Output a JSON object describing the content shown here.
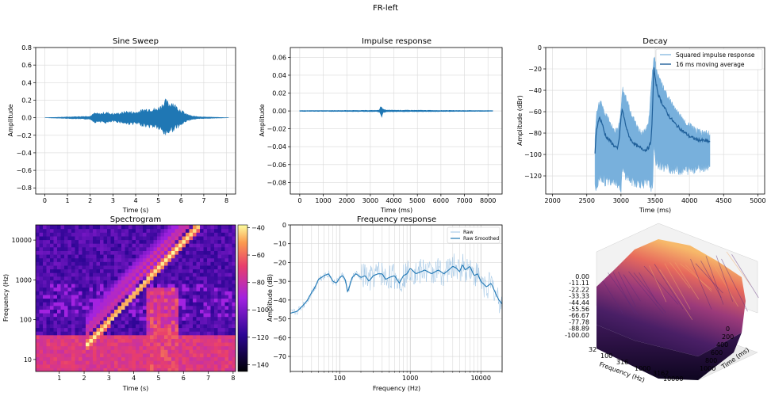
{
  "figure_title": "FR-left",
  "colors": {
    "line": "#1f77b4",
    "line_light": "#6fa8d6",
    "grid": "#d9d9d9"
  },
  "chart_data": [
    {
      "type": "line",
      "title": "Sine Sweep",
      "xlabel": "Time (s)",
      "ylabel": "Amplitude",
      "xlim": [
        -0.4,
        8.4
      ],
      "ylim": [
        -0.87,
        0.8
      ],
      "xticks": [
        "0",
        "1",
        "2",
        "3",
        "4",
        "5",
        "6",
        "7",
        "8"
      ],
      "yticks": [
        "0.8",
        "0.6",
        "0.4",
        "0.2",
        "0.0",
        "−0.2",
        "−0.4",
        "−0.6",
        "−0.8"
      ],
      "grid": true,
      "envelope": {
        "x": [
          0.0,
          1.0,
          2.0,
          2.2,
          2.4,
          2.7,
          3.0,
          3.3,
          3.6,
          4.0,
          4.3,
          4.6,
          4.9,
          5.1,
          5.3,
          5.5,
          5.6,
          5.8,
          6.0,
          6.2,
          6.5,
          7.0,
          8.1
        ],
        "max": [
          0.0,
          0.01,
          0.02,
          0.06,
          0.05,
          0.07,
          0.05,
          0.06,
          0.08,
          0.07,
          0.1,
          0.12,
          0.11,
          0.15,
          0.22,
          0.18,
          0.21,
          0.14,
          0.1,
          0.05,
          0.02,
          0.01,
          0.0
        ],
        "min": [
          0.0,
          -0.01,
          -0.02,
          -0.06,
          -0.05,
          -0.07,
          -0.05,
          -0.06,
          -0.08,
          -0.08,
          -0.1,
          -0.12,
          -0.12,
          -0.17,
          -0.22,
          -0.18,
          -0.17,
          -0.13,
          -0.1,
          -0.05,
          -0.02,
          -0.01,
          0.0
        ]
      }
    },
    {
      "type": "line",
      "title": "Impulse response",
      "xlabel": "Time (ms)",
      "ylabel": "Amplitude",
      "xlim": [
        -400,
        8600
      ],
      "ylim": [
        -0.093,
        0.071
      ],
      "xticks": [
        "0",
        "1000",
        "2000",
        "3000",
        "4000",
        "5000",
        "6000",
        "7000",
        "8000"
      ],
      "yticks": [
        "0.06",
        "0.04",
        "0.02",
        "0.00",
        "−0.02",
        "−0.04",
        "−0.06",
        "−0.08"
      ],
      "grid": true,
      "envelope": {
        "x": [
          0,
          3300,
          3400,
          3450,
          3480,
          3500,
          3550,
          3700,
          8200
        ],
        "max": [
          0.0005,
          0.0008,
          0.002,
          0.006,
          0.008,
          0.004,
          0.002,
          0.001,
          0.0005
        ],
        "min": [
          -0.0005,
          -0.0008,
          -0.002,
          -0.007,
          -0.009,
          -0.005,
          -0.002,
          -0.001,
          -0.0005
        ]
      }
    },
    {
      "type": "line",
      "title": "Decay",
      "xlabel": "Time (ms)",
      "ylabel": "Amplitude (dBr)",
      "xlim": [
        1900,
        5100
      ],
      "ylim": [
        -137,
        0
      ],
      "xticks": [
        "2000",
        "2500",
        "3000",
        "3500",
        "4000",
        "4500",
        "5000"
      ],
      "yticks": [
        "0",
        "−20",
        "−40",
        "−60",
        "−80",
        "−100",
        "−120"
      ],
      "grid": true,
      "legend": "top-right",
      "series": [
        {
          "name": "Squared impulse response",
          "x": [
            2620,
            2640,
            2700,
            2760,
            2800,
            2900,
            2950,
            3000,
            3020,
            3080,
            3150,
            3300,
            3400,
            3460,
            3480,
            3500,
            3550,
            3700,
            3900,
            4100,
            4300
          ],
          "max": [
            -80,
            -60,
            -45,
            -60,
            -62,
            -75,
            -75,
            -55,
            -35,
            -45,
            -60,
            -78,
            -70,
            -20,
            -5,
            -10,
            -25,
            -45,
            -65,
            -75,
            -78
          ],
          "min": [
            -137,
            -137,
            -125,
            -130,
            -130,
            -128,
            -132,
            -137,
            -120,
            -125,
            -130,
            -132,
            -132,
            -137,
            -100,
            -110,
            -115,
            -118,
            -120,
            -118,
            -115
          ]
        },
        {
          "name": "16 ms moving average",
          "x": [
            2620,
            2640,
            2680,
            2720,
            2760,
            2800,
            2850,
            2900,
            2950,
            2980,
            3000,
            3020,
            3060,
            3100,
            3150,
            3200,
            3250,
            3300,
            3350,
            3400,
            3440,
            3460,
            3480,
            3500,
            3550,
            3600,
            3700,
            3800,
            3900,
            4000,
            4100,
            4200,
            4300
          ],
          "y": [
            -100,
            -78,
            -65,
            -70,
            -80,
            -85,
            -88,
            -92,
            -95,
            -82,
            -65,
            -58,
            -70,
            -80,
            -87,
            -90,
            -93,
            -94,
            -96,
            -94,
            -88,
            -60,
            -17,
            -30,
            -45,
            -52,
            -64,
            -72,
            -78,
            -83,
            -86,
            -87,
            -88
          ]
        }
      ]
    },
    {
      "type": "heatmap",
      "title": "Spectrogram",
      "xlabel": "Time (s)",
      "ylabel": "Frequency (Hz)",
      "xlim": [
        0.05,
        8.1
      ],
      "ylim": [
        5,
        24000
      ],
      "yscale": "log",
      "xticks": [
        "1",
        "2",
        "3",
        "4",
        "5",
        "6",
        "7",
        "8"
      ],
      "yticks": [
        "10000",
        "1000",
        "100",
        "10"
      ],
      "colorbar": {
        "range": [
          -145,
          -38
        ],
        "ticks": [
          "−40",
          "−60",
          "−80",
          "−100",
          "−120",
          "−140"
        ]
      },
      "sweep": {
        "start_time": 2.0,
        "end_time": 6.5,
        "start_freq": 20,
        "end_freq": 20000
      }
    },
    {
      "type": "line",
      "title": "Frequency response",
      "xlabel": "Frequency (Hz)",
      "ylabel": "Amplitude (dB)",
      "xlim": [
        20,
        20000
      ],
      "xscale": "log",
      "ylim": [
        -78,
        0
      ],
      "xticks": [
        "100",
        "1000",
        "10000"
      ],
      "yticks": [
        "0",
        "−10",
        "−20",
        "−30",
        "−40",
        "−50",
        "−60",
        "−70"
      ],
      "grid": true,
      "legend": "top-right",
      "series": [
        {
          "name": "Raw",
          "noisy": true
        },
        {
          "name": "Raw Smoothed",
          "x": [
            20,
            25,
            30,
            35,
            40,
            45,
            50,
            60,
            70,
            80,
            90,
            100,
            110,
            120,
            130,
            150,
            170,
            200,
            230,
            260,
            300,
            350,
            400,
            450,
            500,
            600,
            700,
            800,
            900,
            1000,
            1200,
            1400,
            1600,
            1800,
            2000,
            2500,
            3000,
            3500,
            4000,
            4500,
            5000,
            5500,
            6000,
            7000,
            8000,
            9000,
            10000,
            12000,
            14000,
            16000,
            18000,
            20000
          ],
          "y": [
            -47,
            -46,
            -43,
            -40,
            -36,
            -33,
            -29,
            -27,
            -26,
            -30,
            -31,
            -28,
            -27,
            -29,
            -36,
            -28,
            -26,
            -28,
            -27,
            -30,
            -27,
            -26,
            -26,
            -29,
            -28,
            -27,
            -31,
            -27,
            -26,
            -23,
            -26,
            -25,
            -24,
            -25,
            -26,
            -24,
            -26,
            -24,
            -22,
            -23,
            -25,
            -21,
            -24,
            -22,
            -27,
            -26,
            -30,
            -33,
            -31,
            -36,
            -40,
            -42
          ]
        }
      ]
    },
    {
      "type": "surface3d",
      "zticks": [
        "0.00",
        "-11.11",
        "-22.22",
        "-33.33",
        "-44.44",
        "-55.56",
        "-66.67",
        "-77.78",
        "-88.89",
        "-100.00"
      ],
      "xticks": [
        "32",
        "100",
        "316",
        "1000",
        "3162",
        "10000"
      ],
      "yticks": [
        "0",
        "200",
        "400",
        "600",
        "800",
        "1000"
      ],
      "xlabel": "Frequency (Hz)",
      "ylabel": "Time (ms)"
    }
  ]
}
